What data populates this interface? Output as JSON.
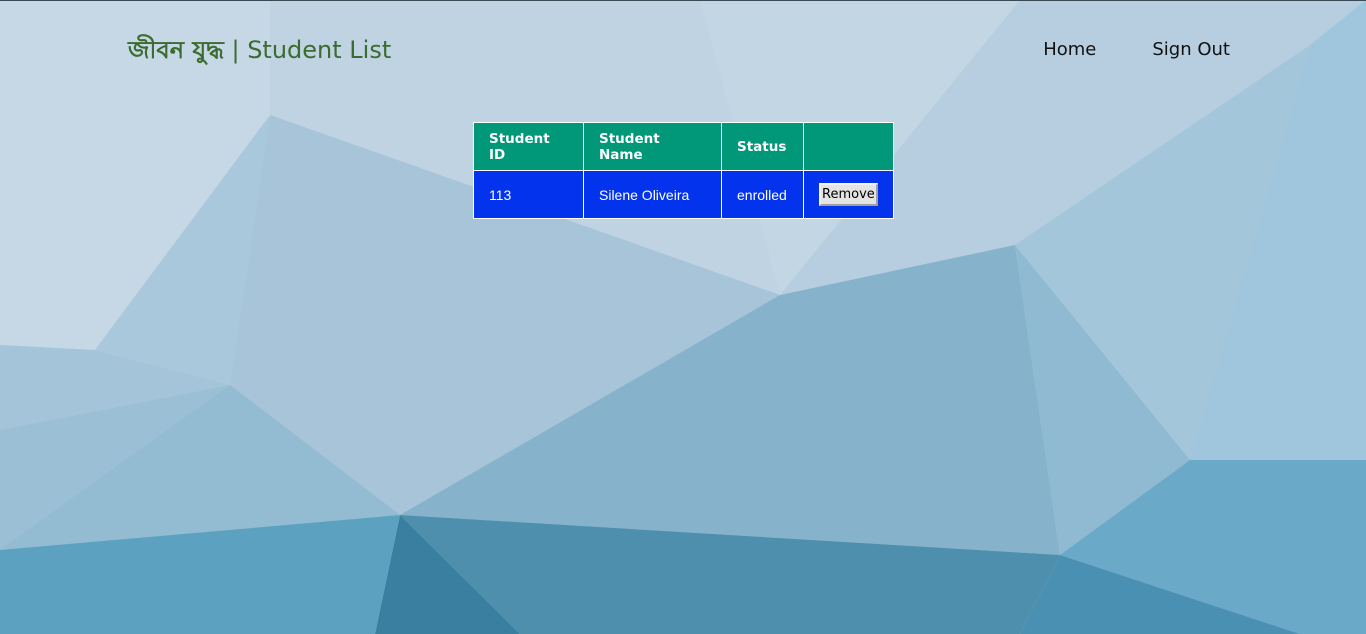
{
  "header": {
    "brand_bengali": "জীবন যুদ্ধ",
    "brand_separator": "|",
    "brand_page": "Student List"
  },
  "nav": {
    "home": "Home",
    "sign_out": "Sign Out"
  },
  "table": {
    "columns": [
      "Student ID",
      "Student Name",
      "Status",
      ""
    ],
    "rows": [
      {
        "id": "113",
        "name": "Silene Oliveira",
        "status": "enrolled",
        "action": "Remove"
      }
    ]
  },
  "colors": {
    "brand_text": "#3c6b2f",
    "header_bg": "#009879",
    "row_bg": "#0433ee"
  }
}
